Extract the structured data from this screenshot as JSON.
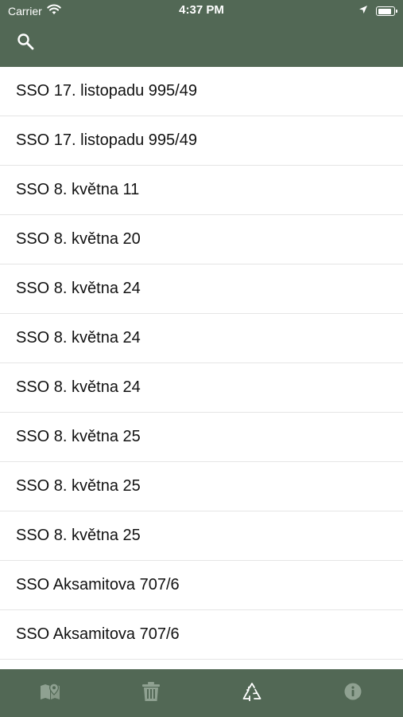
{
  "status_bar": {
    "carrier": "Carrier",
    "time": "4:37 PM",
    "battery_level": 0.9
  },
  "nav": {
    "search_icon": "search-icon"
  },
  "list": {
    "items": [
      {
        "label": "SSO 17. listopadu 995/49"
      },
      {
        "label": "SSO 17. listopadu 995/49"
      },
      {
        "label": "SSO 8. května 11"
      },
      {
        "label": "SSO 8. května 20"
      },
      {
        "label": "SSO 8. května 24"
      },
      {
        "label": "SSO 8. května 24"
      },
      {
        "label": "SSO 8. května 24"
      },
      {
        "label": "SSO 8. května 25"
      },
      {
        "label": "SSO 8. května 25"
      },
      {
        "label": "SSO 8. května 25"
      },
      {
        "label": "SSO Aksamitova 707/6"
      },
      {
        "label": "SSO Aksamitova 707/6"
      }
    ]
  },
  "tabbar": {
    "tabs": [
      {
        "icon": "map-pin-icon",
        "active": false
      },
      {
        "icon": "trash-icon",
        "active": false
      },
      {
        "icon": "recycle-icon",
        "active": true
      },
      {
        "icon": "info-icon",
        "active": false
      }
    ]
  },
  "colors": {
    "header_bg": "#526855",
    "tab_active": "#ffffff",
    "tab_inactive": "#8fa191"
  }
}
